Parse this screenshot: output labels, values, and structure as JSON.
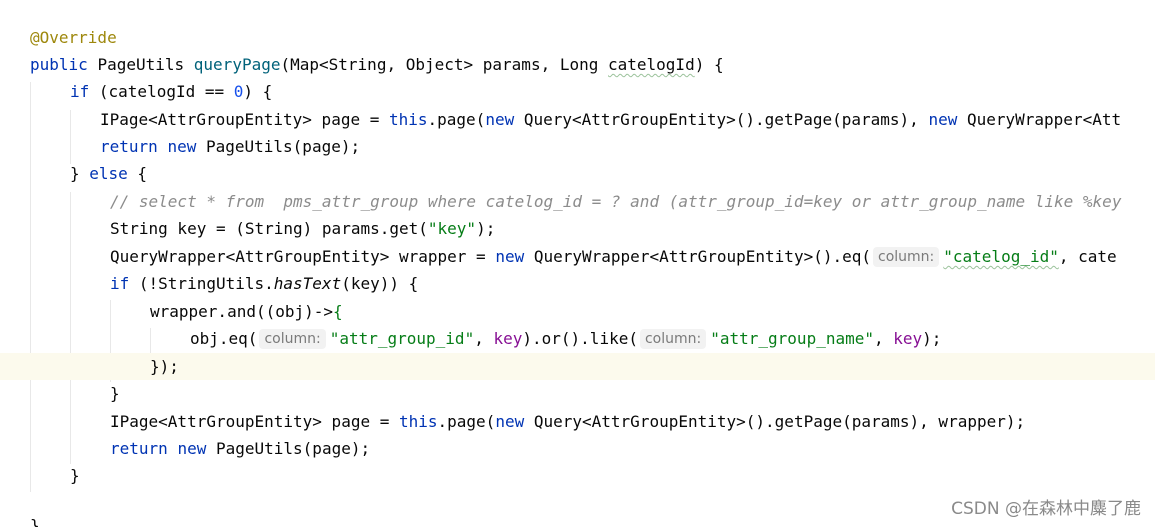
{
  "code": {
    "annotation": "@Override",
    "hint_label": "column:",
    "signature": {
      "kw_public": "public",
      "return_type": "PageUtils",
      "method_name": "queryPage",
      "params_a": "(Map<String, Object> params, Long ",
      "param_catelogId": "catelogId",
      "params_b": ") {"
    },
    "if1": {
      "kw": "if",
      "cond": " (catelogId == ",
      "zero": "0",
      "tail": ") {"
    },
    "page1": {
      "type": "IPage<AttrGroupEntity> page = ",
      "kw_this": "this",
      "mid": ".page(",
      "kw_new": "new",
      "query": " Query<AttrGroupEntity>().getPage(params), ",
      "kw_new2": "new",
      "tail": " QueryWrapper<Att"
    },
    "return1": {
      "kw": "return",
      "kw_new": "new",
      "tail": " PageUtils(page);"
    },
    "else_line": {
      "brace": "} ",
      "kw": "else",
      "tail": " {"
    },
    "comment": "// select * from  pms_attr_group where catelog_id = ? and (attr_group_id=key or attr_group_name like %key",
    "key_line": {
      "pre": "String key = (String) params.get(",
      "str": "\"key\"",
      "post": ");"
    },
    "wrapper_line": {
      "pre": "QueryWrapper<AttrGroupEntity> wrapper = ",
      "kw_new": "new",
      "mid": " QueryWrapper<AttrGroupEntity>().eq(",
      "str": "\"catelog_id\"",
      "post": ", cate"
    },
    "if2": {
      "kw": "if",
      "pre": " (!StringUtils.",
      "method": "hasText",
      "post": "(key)) {"
    },
    "and_line": {
      "text": "wrapper.and((obj)->",
      "brace": "{"
    },
    "obj_line": {
      "pre": "obj.eq(",
      "str1": "\"attr_group_id\"",
      "comma1": ", ",
      "key1": "key",
      "mid": ").or().like(",
      "str2": "\"attr_group_name\"",
      "comma2": ", ",
      "key2": "key",
      "post": ");"
    },
    "close_lambda": "});",
    "close_brace": "}",
    "page2": {
      "type": "IPage<AttrGroupEntity> page = ",
      "kw_this": "this",
      "mid": ".page(",
      "kw_new": "new",
      "tail": " Query<AttrGroupEntity>().getPage(params), wrapper);"
    },
    "return2": {
      "kw": "return",
      "kw_new": "new",
      "tail": " PageUtils(page);"
    },
    "close_else": "}",
    "close_method": "}"
  },
  "watermark": "CSDN @在森林中麋了鹿",
  "colors": {
    "keyword": "#0033b3",
    "string": "#067d17",
    "number": "#1750eb",
    "annotation": "#9e880d",
    "comment": "#8c8c8c",
    "method": "#00627a",
    "parameter": "#871094",
    "current_line": "#fcfaed"
  }
}
